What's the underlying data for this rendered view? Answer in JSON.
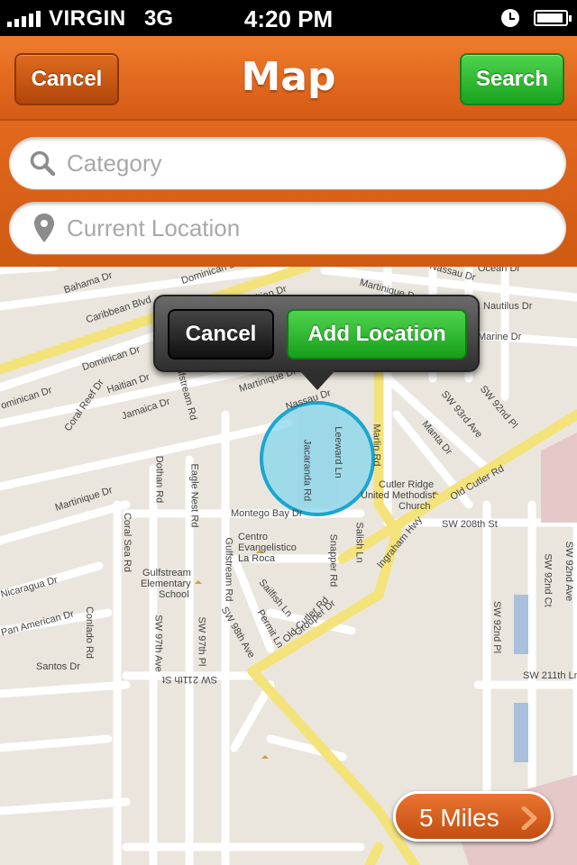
{
  "status_bar": {
    "carrier": "VIRGIN",
    "network": "3G",
    "time": "4:20 PM"
  },
  "nav": {
    "title": "Map",
    "cancel_label": "Cancel",
    "search_label": "Search"
  },
  "search": {
    "category_placeholder": "Category",
    "location_placeholder": "Current Location"
  },
  "popover": {
    "cancel_label": "Cancel",
    "add_label": "Add Location"
  },
  "map": {
    "distance_label": "5 Miles",
    "labels": {
      "bahama": "Bahama Dr",
      "dominican_top": "Dominican Dr",
      "caribbean": "Caribbean Blvd",
      "haitian_top": "Haitian Dr",
      "martinique_top": "Martinique Dr",
      "nassau_top": "Nassau Dr",
      "ocean": "Ocean Dr",
      "nautilus": "Nautilus Dr",
      "marine": "Marine Dr",
      "dominican_mid": "Dominican Dr",
      "haitian_mid": "Haitian Dr",
      "ominican_left": "ominican Dr",
      "coral_reef": "Coral Reef Dr",
      "jamaica": "Jamaica Dr",
      "gulfstream_rd": "Gulfstream Rd",
      "martinique_mid": "Martinique Dr",
      "nassau_mid": "Nassau Dr",
      "sw92ave": "SW 93rd Ave",
      "sw92pl": "SW 92nd Pl",
      "manta": "Manta Dr",
      "leeward": "Leeward Ln",
      "jacaranda": "Jacaranda Rd",
      "marlin": "Marlin Rd",
      "old_cutler_top": "Old Cutler Rd",
      "martinique_low": "Martinique Dr",
      "dothan": "Dothan Rd",
      "eagle_nest": "Eagle Nest Rd",
      "cutler_ridge": "Cutler Ridge",
      "united_methodist": "United Methodist",
      "church": "Church",
      "montego": "Montego Bay Dr",
      "sw208": "SW 208th St",
      "coral_sea": "Coral Sea Rd",
      "gulfstream_rd2": "Gulfstream Rd",
      "centro": "Centro",
      "evangelistico": "Evangelistico",
      "la_roca": "La Roca",
      "salish": "Salish Ln",
      "snapper": "Snapper Rd",
      "ingraham": "Ingraham Hwy",
      "sw92ave2": "SW 92nd Ave",
      "sw92ct": "SW 92nd Ct",
      "gulfstream_school": "Gulfstream",
      "elementary": "Elementary",
      "school": "School",
      "nicaragua": "Nicaragua Dr",
      "sailfish": "Sailfish Ln",
      "grouper": "Grouper Dr",
      "permit": "Permit Ln",
      "sw97ave": "SW 97th Ave",
      "pan_american": "Pan American Dr",
      "conlado": "Conlado Rd",
      "sw97pl": "SW 97th Pl",
      "sw98ave": "SW 98th Ave",
      "old_cutler_mid": "Old Cutler Rd",
      "sw92nd_pl2": "SW 92nd Pl",
      "sw211": "SW 211th Ln",
      "santos": "Santos Dr",
      "sw211st_mirror": "SW 211th St"
    }
  }
}
